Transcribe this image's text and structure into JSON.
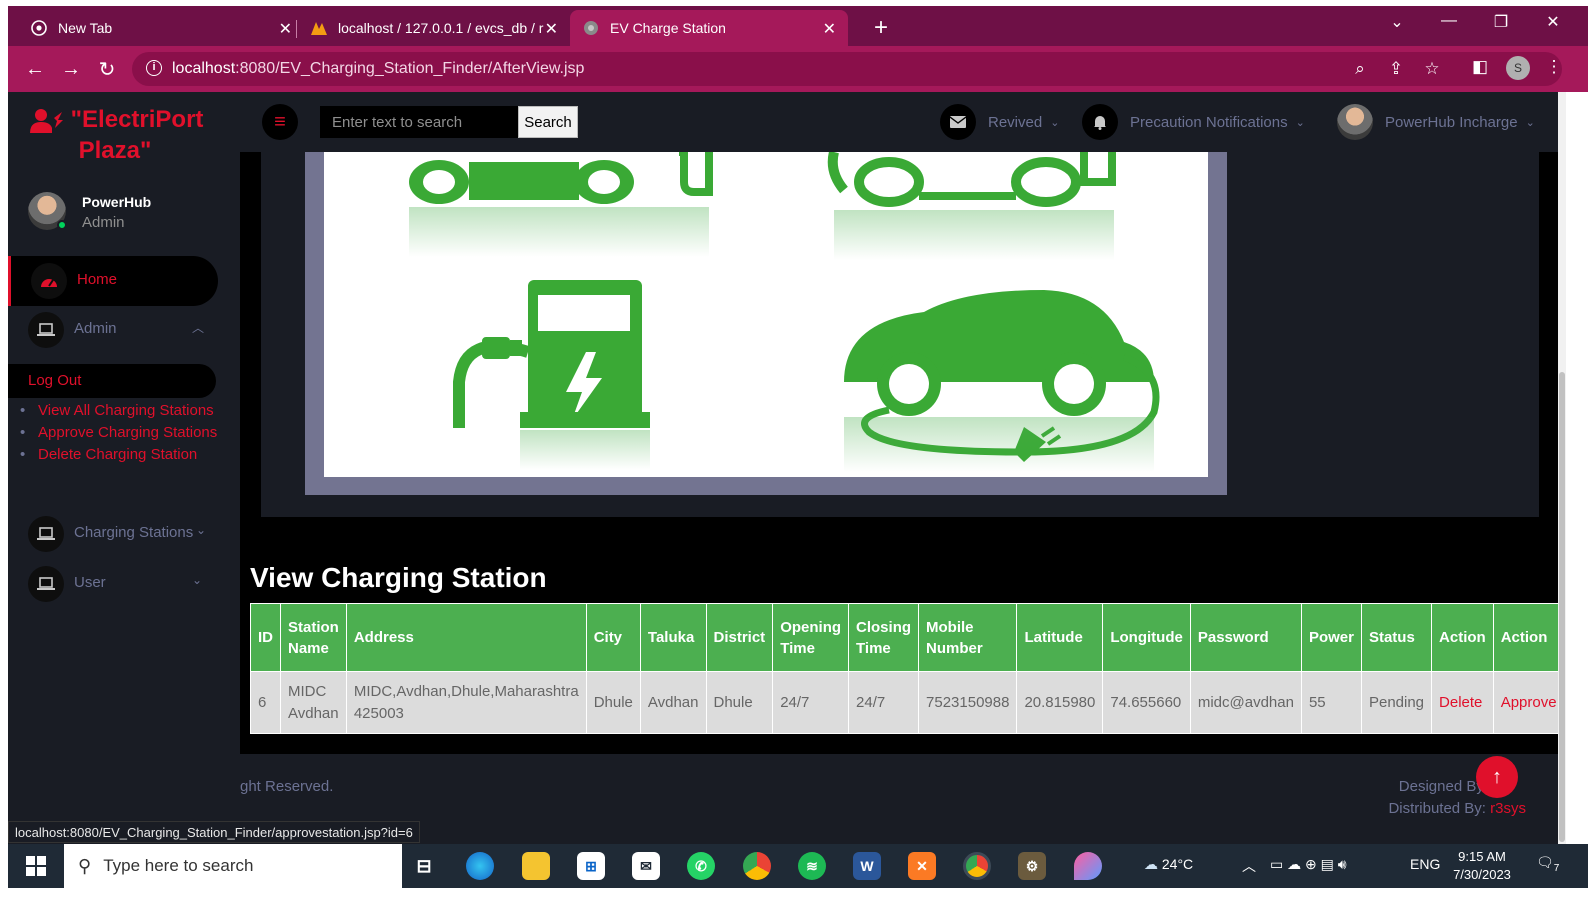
{
  "browser": {
    "tabs": [
      {
        "title": "New Tab",
        "close": "✕"
      },
      {
        "title": "localhost / 127.0.0.1 / evcs_db / r",
        "close": "✕"
      },
      {
        "title": "EV Charge Station",
        "close": "✕"
      }
    ],
    "new_tab": "+",
    "url_host": "localhost",
    "url_path": ":8080/EV_Charging_Station_Finder/AfterView.jsp",
    "profile_initial": "S",
    "status_url": "localhost:8080/EV_Charging_Station_Finder/approvestation.jsp?id=6"
  },
  "brand": {
    "line1": "\"ElectriPort",
    "line2": "Plaza\"",
    "accent": "#e0102b"
  },
  "profile": {
    "name": "PowerHub",
    "role": "Admin"
  },
  "sidebar": {
    "items": [
      {
        "label": "Home",
        "icon": "speedometer-icon"
      },
      {
        "label": "Admin",
        "icon": "laptop-icon",
        "arrow": "^"
      },
      {
        "label": "Charging Stations",
        "icon": "laptop-icon",
        "arrow": "v"
      },
      {
        "label": "User",
        "icon": "laptop-icon",
        "arrow": "v"
      }
    ],
    "logout": "Log Out",
    "submenu": [
      "View All Charging Stations",
      "Approve Charging Stations",
      "Delete Charging Station"
    ]
  },
  "topbar": {
    "search_placeholder": "Enter text to search",
    "search_button": "Search",
    "messages": "Revived",
    "notifications": "Precaution Notifications",
    "user": "PowerHub Incharge"
  },
  "main": {
    "section_title": "View Charging Station",
    "table": {
      "headers": [
        [
          "ID"
        ],
        [
          "Station",
          "Name"
        ],
        [
          "Address"
        ],
        [
          "City"
        ],
        [
          "Taluka"
        ],
        [
          "District"
        ],
        [
          "Opening",
          "Time"
        ],
        [
          "Closing",
          "Time"
        ],
        [
          "Mobile",
          "Number"
        ],
        [
          "Latitude"
        ],
        [
          "Longitude"
        ],
        [
          "Password"
        ],
        [
          "Power"
        ],
        [
          "Status"
        ],
        [
          "Action"
        ],
        [
          "Action"
        ]
      ],
      "rows": [
        {
          "id": "6",
          "name": [
            "MIDC",
            "Avdhan"
          ],
          "address": [
            "MIDC,Avdhan,Dhule,Maharashtra",
            "425003"
          ],
          "city": "Dhule",
          "taluka": "Avdhan",
          "district": "Dhule",
          "opening": "24/7",
          "closing": "24/7",
          "mobile": "7523150988",
          "latitude": "20.815980",
          "longitude": "74.655660",
          "password": "midc@avdhan",
          "power": "55",
          "status": "Pending",
          "action_delete": "Delete",
          "action_approve": "Approve"
        }
      ]
    }
  },
  "footer": {
    "left": "ght Reserved.",
    "designed_by": "Designed By:",
    "distributed_by": "Distributed By: ",
    "distributor": "r3sys"
  },
  "scroll_top": "↑",
  "taskbar": {
    "search_placeholder": "Type here to search",
    "weather": "24°C",
    "lang": "ENG",
    "time": "9:15 AM",
    "date": "7/30/2023",
    "notification_count": "7"
  }
}
